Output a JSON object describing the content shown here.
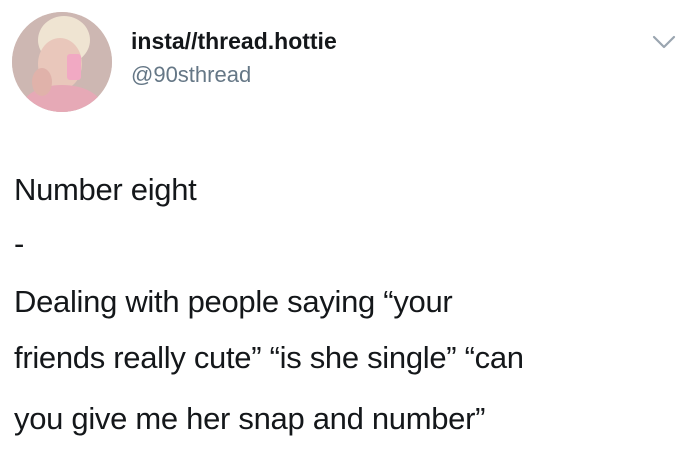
{
  "tweet": {
    "display_name": "insta//thread.hottie",
    "handle": "@90sthread",
    "avatar_icon": "profile-photo",
    "menu_icon": "chevron-down-icon",
    "lines": [
      "Number eight",
      "-",
      "Dealing with people saying “your",
      "friends really cute” “is she single” “can",
      "you give me her snap and number”"
    ]
  },
  "colors": {
    "text": "#14171a",
    "secondary_text": "#657786",
    "background": "#ffffff"
  }
}
